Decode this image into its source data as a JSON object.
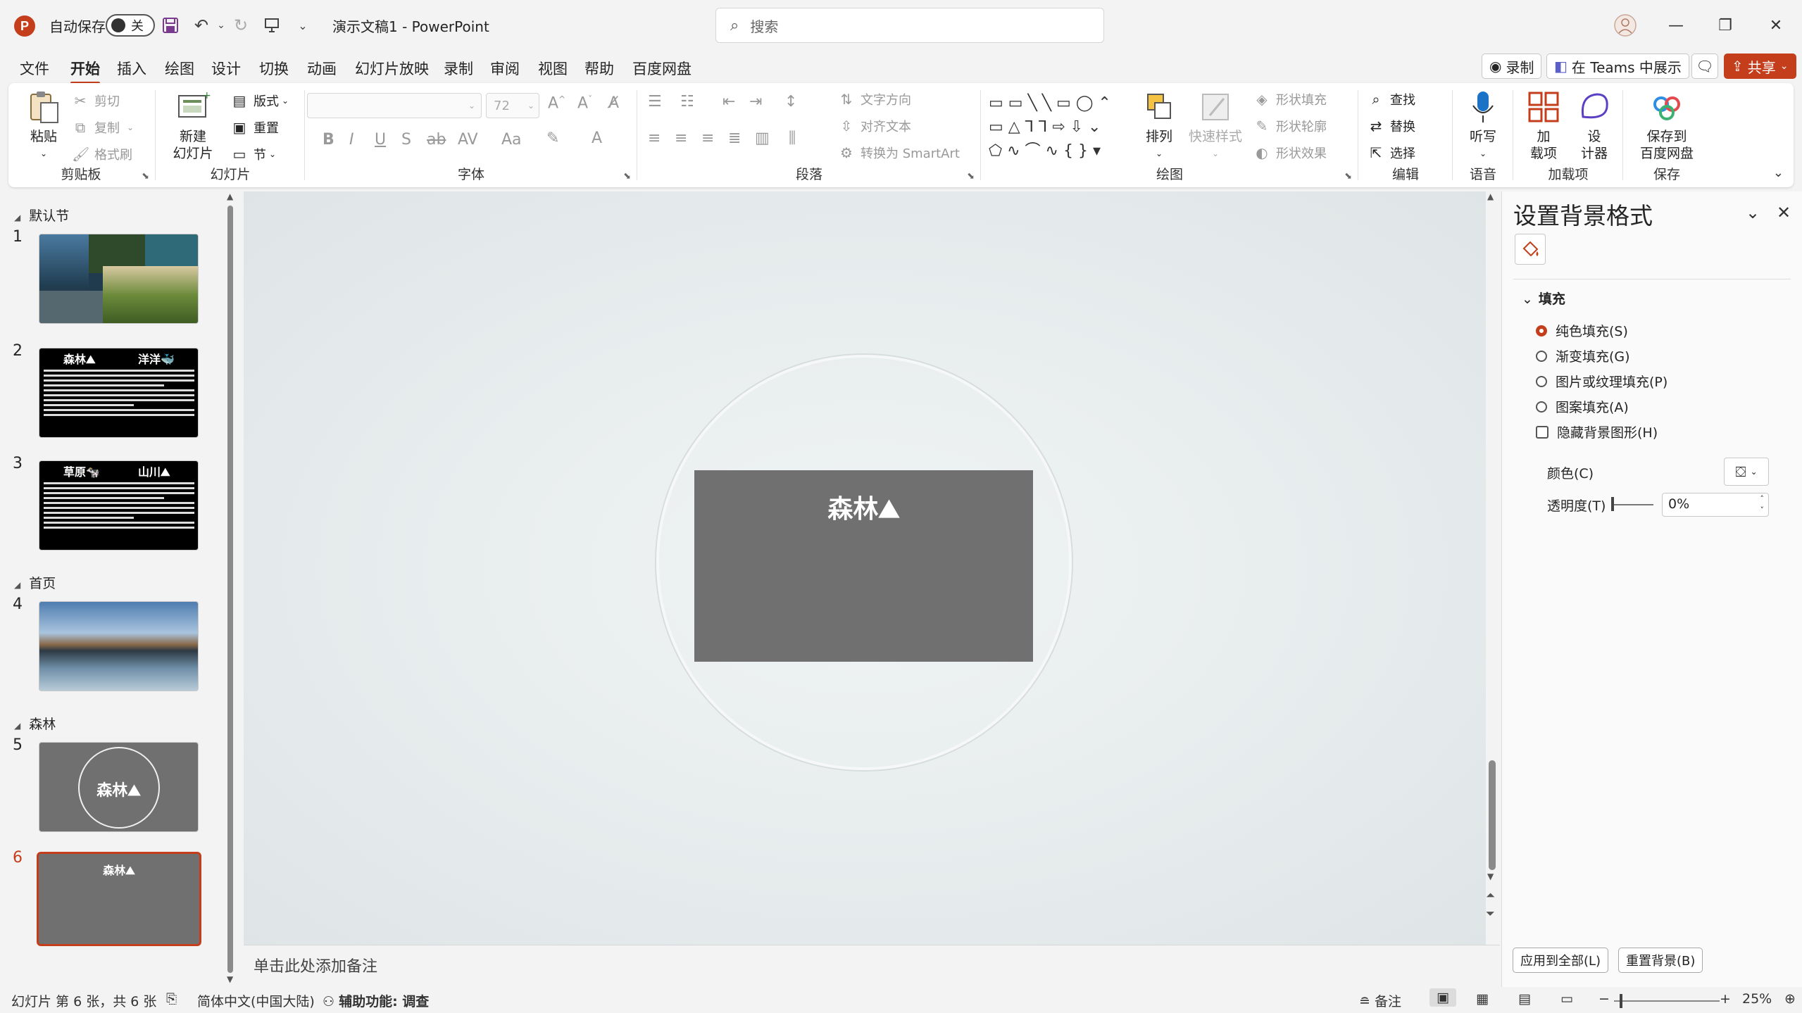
{
  "titlebar": {
    "autosave_label": "自动保存",
    "autosave_state": "关",
    "doc_title": "演示文稿1  -  PowerPoint",
    "search_placeholder": "搜索"
  },
  "menu": {
    "tabs": [
      "文件",
      "开始",
      "插入",
      "绘图",
      "设计",
      "切换",
      "动画",
      "幻灯片放映",
      "录制",
      "审阅",
      "视图",
      "帮助",
      "百度网盘"
    ],
    "active": "开始",
    "record_label": "录制",
    "teams_label": "在 Teams 中展示",
    "share_label": "共享"
  },
  "ribbon": {
    "clipboard": {
      "label": "剪贴板",
      "paste": "粘贴",
      "cut": "剪切",
      "copy": "复制",
      "format_painter": "格式刷"
    },
    "slides": {
      "label": "幻灯片",
      "new_slide_1": "新建",
      "new_slide_2": "幻灯片",
      "layout": "版式",
      "reset": "重置",
      "section": "节"
    },
    "font": {
      "label": "字体",
      "size": "72"
    },
    "paragraph": {
      "label": "段落",
      "text_direction": "文字方向",
      "align_text": "对齐文本",
      "smartart": "转换为 SmartArt"
    },
    "drawing": {
      "label": "绘图",
      "arrange": "排列",
      "quick_styles": "快速样式",
      "shape_fill": "形状填充",
      "shape_outline": "形状轮廓",
      "shape_effects": "形状效果"
    },
    "editing": {
      "label": "编辑",
      "find": "查找",
      "replace": "替换",
      "select": "选择"
    },
    "voice": {
      "label": "语音",
      "dictate": "听写"
    },
    "addins": {
      "label": "加载项",
      "addins_1": "加",
      "addins_2": "载项",
      "designer_1": "设",
      "designer_2": "计器"
    },
    "save": {
      "label": "保存",
      "save_1": "保存到",
      "save_2": "百度网盘"
    }
  },
  "thumbnails": {
    "sections": [
      {
        "name": "默认节"
      },
      {
        "name": "首页"
      },
      {
        "name": "森林"
      }
    ],
    "slides": [
      {
        "num": "1"
      },
      {
        "num": "2",
        "left_title": "森林⛰",
        "right_title": "洋洋🐳"
      },
      {
        "num": "3",
        "left_title": "草原🐄",
        "right_title": "山川⛰"
      },
      {
        "num": "4"
      },
      {
        "num": "5",
        "title": "森林⛰"
      },
      {
        "num": "6",
        "title": "森林⛰"
      }
    ],
    "selected": "6"
  },
  "slide": {
    "title": "森林⛰"
  },
  "notes_placeholder": "单击此处添加备注",
  "format_pane": {
    "title": "设置背景格式",
    "section": "填充",
    "options": [
      {
        "label": "纯色填充(S)",
        "checked": true
      },
      {
        "label": "渐变填充(G)",
        "checked": false
      },
      {
        "label": "图片或纹理填充(P)",
        "checked": false
      },
      {
        "label": "图案填充(A)",
        "checked": false
      }
    ],
    "hide_graphics": "隐藏背景图形(H)",
    "color_label": "颜色(C)",
    "transparency_label": "透明度(T)",
    "transparency_value": "0%",
    "apply_all": "应用到全部(L)",
    "reset_bg": "重置背景(B)"
  },
  "statusbar": {
    "slide_info": "幻灯片 第 6 张，共 6 张",
    "language": "简体中文(中国大陆)",
    "accessibility": "辅助功能: 调查",
    "notes": "备注",
    "zoom": "25%"
  },
  "colors": {
    "accent": "#c43e1c",
    "slide_bg": "#707070"
  }
}
